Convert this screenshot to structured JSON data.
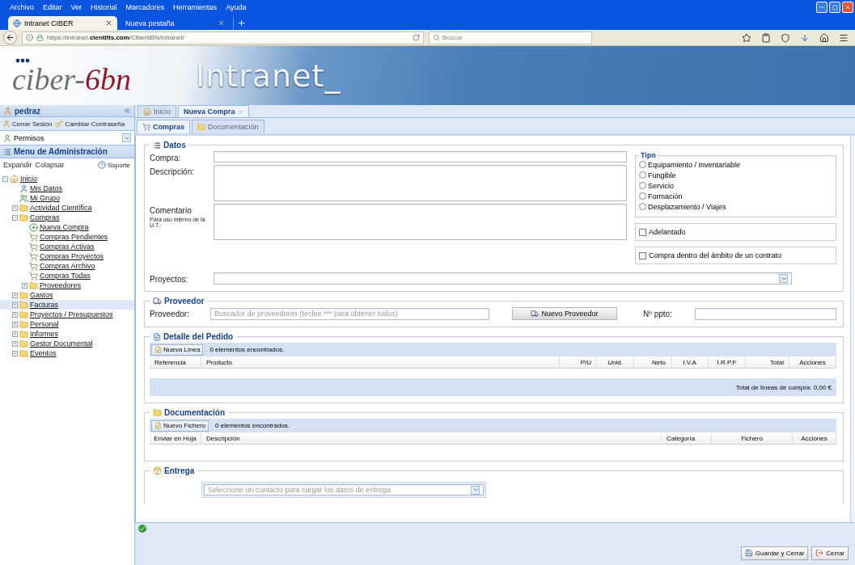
{
  "browser": {
    "menu": [
      "Archivo",
      "Editar",
      "Ver",
      "Historial",
      "Marcadores",
      "Herramientas",
      "Ayuda"
    ],
    "tabs": [
      {
        "label": "Intranet CIBER",
        "selected": true
      },
      {
        "label": "Nueva pestaña",
        "selected": false
      }
    ],
    "url": "https://intranet.**cientifis.com**/Ciber6BN/intranet/",
    "search": {
      "placeholder": "Buscar"
    }
  },
  "banner": {
    "logo_lead": "ciber-",
    "logo_accent": "6bn",
    "title": "Intranet_"
  },
  "sidebar": {
    "user": "pedraz",
    "actions": [
      "Cerrar Sesión",
      "Cambiar Contraseña"
    ],
    "permissions": "Permisos",
    "menu_title": "Menu de Administración",
    "expand": "Expandir",
    "collapse": "Colapsar",
    "support": "Soporte",
    "tree": [
      {
        "label": "Inicio",
        "kind": "home",
        "expanded": true,
        "selected": false,
        "children": [
          {
            "label": "Mis Datos",
            "kind": "user",
            "selected": false
          },
          {
            "label": "Mi Grupo",
            "kind": "group",
            "selected": false
          },
          {
            "label": "Actividad Científica",
            "kind": "folder",
            "expanded": false,
            "selected": false
          },
          {
            "label": "Compras",
            "kind": "folder",
            "expanded": true,
            "selected": false,
            "children": [
              {
                "label": "Nueva Compra",
                "kind": "add",
                "selected": false
              },
              {
                "label": "Compras Pendientes",
                "kind": "cart",
                "selected": false
              },
              {
                "label": "Compras Activas",
                "kind": "cart",
                "selected": false
              },
              {
                "label": "Compras Proyectos",
                "kind": "cart",
                "selected": false
              },
              {
                "label": "Compras Archivo",
                "kind": "cart",
                "selected": false
              },
              {
                "label": "Compras Todas",
                "kind": "cart",
                "selected": false
              },
              {
                "label": "Proveedores",
                "kind": "folder",
                "expanded": false,
                "selected": false
              }
            ]
          },
          {
            "label": "Gastos",
            "kind": "folder",
            "expanded": false,
            "selected": false
          },
          {
            "label": "Facturas",
            "kind": "folder",
            "expanded": false,
            "selected": true
          },
          {
            "label": "Proyectos / Presupuestos",
            "kind": "folder",
            "expanded": false,
            "selected": false
          },
          {
            "label": "Personal",
            "kind": "folder",
            "expanded": false,
            "selected": false
          },
          {
            "label": "Informes",
            "kind": "folder",
            "expanded": false,
            "selected": false
          },
          {
            "label": "Gestor Documental",
            "kind": "folder",
            "expanded": false,
            "selected": false
          },
          {
            "label": "Eventos",
            "kind": "folder",
            "expanded": false,
            "selected": false
          }
        ]
      }
    ]
  },
  "app_tabs": [
    {
      "label": "Inicio",
      "kind": "home",
      "selected": false
    },
    {
      "label": "Nueva Compra",
      "kind": "closable",
      "selected": true
    }
  ],
  "sub_tabs": [
    {
      "label": "Compras",
      "selected": true
    },
    {
      "label": "Documentación",
      "selected": false
    }
  ],
  "datos": {
    "title": "Datos",
    "compra_label": "Compra:",
    "descripcion_label": "Descripción:",
    "comentario_label": "Comentario",
    "comentario_hint": "Para uso interno de la U.T.:",
    "proyectos_label": "Proyectos:",
    "tipo": {
      "title": "Tipo",
      "options": [
        {
          "label": "Equipamiento / Inventariable",
          "selected": false
        },
        {
          "label": "Fungible",
          "selected": false
        },
        {
          "label": "Servicio",
          "selected": false
        },
        {
          "label": "Formación",
          "selected": false
        },
        {
          "label": "Desplazamiento / Viajes",
          "selected": false
        }
      ]
    },
    "checks": [
      {
        "label": "Adelantado",
        "checked": false
      },
      {
        "label": "Compra dentro del ámbito de un contrato",
        "checked": false
      }
    ]
  },
  "proveedor": {
    "title": "Proveedor",
    "label": "Proveedor:",
    "placeholder": "Buscador de proveedores (teclee *** para obtener todos)",
    "button": "Nuevo Proveedor",
    "ppto_label": "Nº ppto:"
  },
  "detalle": {
    "title": "Detalle del Pedido",
    "button": "Nueva Línea",
    "count": "0 elementos encontrados.",
    "columns": [
      "Referencia",
      "Producto",
      "P/U",
      "Unid.",
      "Neto",
      "I.V.A",
      "I.R.P.F",
      "Total",
      "Acciones"
    ],
    "total": "Total de líneas de compra: 0,00 €"
  },
  "documentacion": {
    "title": "Documentación",
    "button": "Nuevo Fichero",
    "count": "0 elementos encontrados.",
    "columns": [
      "Enviar en Hoja",
      "Descripción",
      "Categoría",
      "Fichero",
      "Acciones"
    ]
  },
  "entrega": {
    "title": "Entrega",
    "placeholder": "Seleccione un contacto para cargar los datos de entrega"
  },
  "footer": {
    "buttons": [
      "Guardar y Cerrar",
      "Cerrar"
    ]
  }
}
